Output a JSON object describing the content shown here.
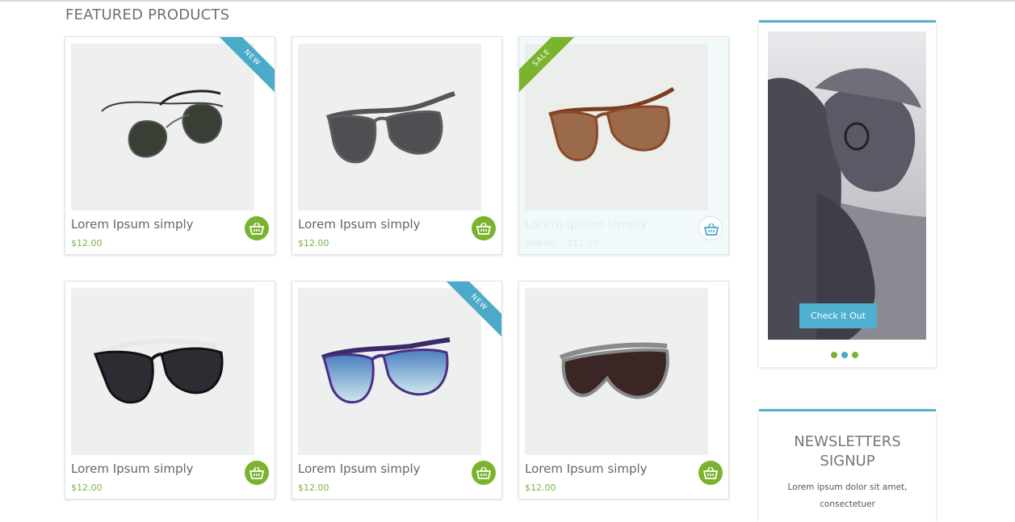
{
  "section": {
    "title": "FEATURED PRODUCTS"
  },
  "products": [
    {
      "name": "Lorem Ipsum simply",
      "price": "$12.00",
      "badge": "NEW",
      "image": "aviator-sunglasses-green"
    },
    {
      "name": "Lorem Ipsum simply",
      "price": "$12.00",
      "badge": "",
      "image": "wayfarer-sunglasses-grey"
    },
    {
      "name": "Lorem Ipsum simply",
      "price": "$12.00",
      "old_price": "$50.00",
      "badge": "SALE",
      "image": "wayfarer-sunglasses-brown"
    },
    {
      "name": "Lorem Ipsum simply",
      "price": "$12.00",
      "badge": "",
      "image": "shield-sunglasses-black-white"
    },
    {
      "name": "Lorem Ipsum simply",
      "price": "$12.00",
      "badge": "NEW",
      "image": "wayfarer-sunglasses-purple-blue"
    },
    {
      "name": "Lorem Ipsum simply",
      "price": "$12.00",
      "badge": "",
      "image": "wrap-sunglasses-brown"
    }
  ],
  "cart_icon": "basket-icon",
  "promo": {
    "button_label": "Check it Out",
    "dots": 3,
    "active_dot": 1
  },
  "newsletter": {
    "title": "NEWSLETTERS SIGNUP",
    "text": "Lorem ipsum dolor sit amet, consectetuer"
  },
  "colors": {
    "accent_green": "#7ab32e",
    "accent_blue": "#4aaac8",
    "price_green": "#7cb342"
  }
}
